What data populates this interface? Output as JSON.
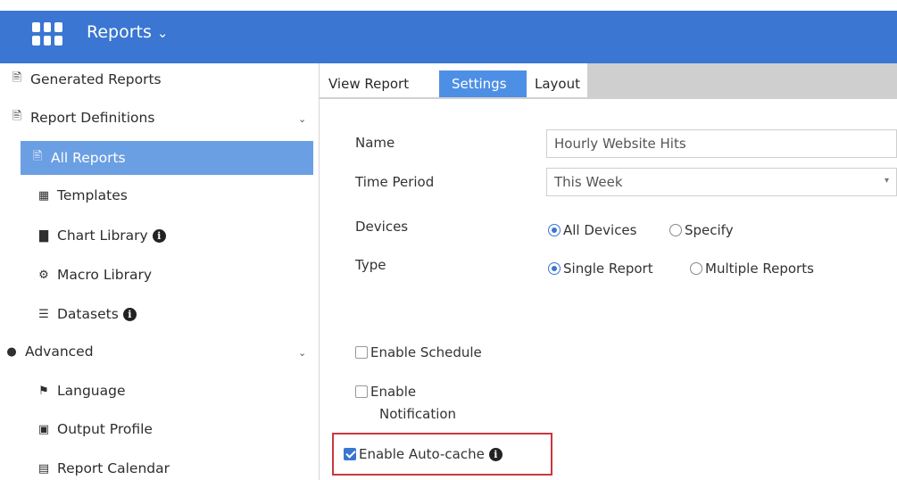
{
  "header": {
    "title": "Reports"
  },
  "sidebar": {
    "items": [
      {
        "label": "Generated Reports",
        "icon": "report-icon"
      },
      {
        "label": "Report Definitions",
        "icon": "report-icon"
      },
      {
        "label": "All Reports",
        "icon": "report-icon"
      },
      {
        "label": "Templates",
        "icon": "template-icon"
      },
      {
        "label": "Chart Library",
        "icon": "chart-icon"
      },
      {
        "label": "Macro Library",
        "icon": "macro-icon"
      },
      {
        "label": "Datasets",
        "icon": "dataset-icon"
      },
      {
        "label": "Advanced",
        "icon": "advanced-icon"
      },
      {
        "label": "Language",
        "icon": "flag-icon"
      },
      {
        "label": "Output Profile",
        "icon": "output-icon"
      },
      {
        "label": "Report Calendar",
        "icon": "calendar-icon"
      }
    ]
  },
  "tabs": [
    {
      "label": "View Report"
    },
    {
      "label": "Settings"
    },
    {
      "label": "Layout"
    }
  ],
  "form": {
    "name_label": "Name",
    "name_value": "Hourly Website Hits",
    "time_period_label": "Time Period",
    "time_period_value": "This Week",
    "devices_label": "Devices",
    "devices_all": "All Devices",
    "devices_specify": "Specify",
    "type_label": "Type",
    "type_single": "Single Report",
    "type_multiple": "Multiple Reports",
    "enable_schedule": "Enable Schedule",
    "enable_notification_1": "Enable",
    "enable_notification_2": "Notification",
    "enable_autocache": "Enable Auto-cache"
  },
  "colors": {
    "accent": "#3a76d2",
    "active_item": "#6b9fe3",
    "settings_tab": "#4e8fe6",
    "highlight": "#c9383d"
  }
}
